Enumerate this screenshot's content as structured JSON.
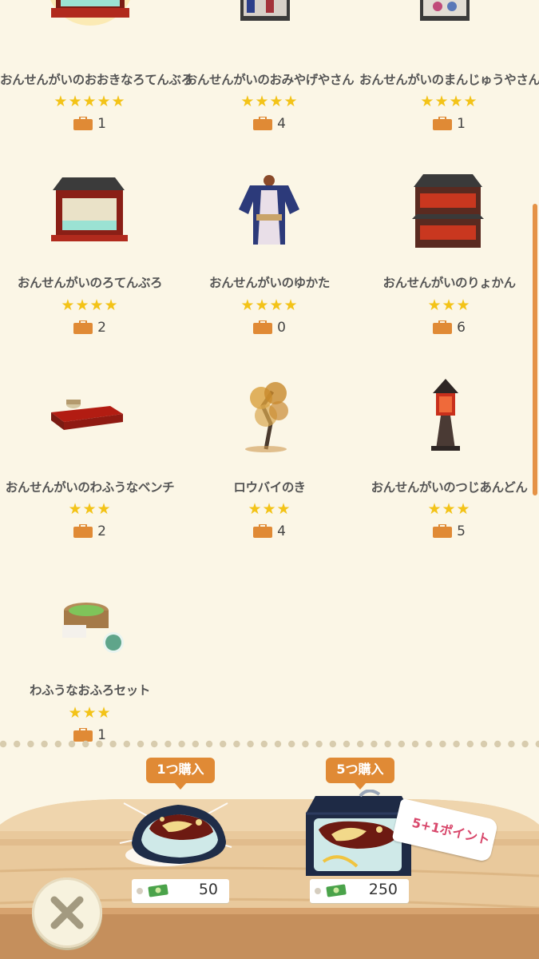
{
  "items": [
    {
      "name": "おんせんがいのおおきなろてんぶろ",
      "stars": "★★★★★",
      "count": "1",
      "art": "big-bath"
    },
    {
      "name": "おんせんがいのおみやげやさん",
      "stars": "★★★★",
      "count": "4",
      "art": "souvenir-shop"
    },
    {
      "name": "おんせんがいのまんじゅうやさん",
      "stars": "★★★★",
      "count": "1",
      "art": "manju-shop"
    },
    {
      "name": "おんせんがいのろてんぶろ",
      "stars": "★★★★",
      "count": "2",
      "art": "bath"
    },
    {
      "name": "おんせんがいのゆかた",
      "stars": "★★★★",
      "count": "0",
      "art": "yukata"
    },
    {
      "name": "おんせんがいのりょかん",
      "stars": "★★★",
      "count": "6",
      "art": "ryokan"
    },
    {
      "name": "おんせんがいのわふうなベンチ",
      "stars": "★★★",
      "count": "2",
      "art": "bench"
    },
    {
      "name": "ロウバイのき",
      "stars": "★★★",
      "count": "4",
      "art": "tree"
    },
    {
      "name": "おんせんがいのつじあんどん",
      "stars": "★★★",
      "count": "5",
      "art": "lantern"
    },
    {
      "name": "わふうなおふろセット",
      "stars": "★★★",
      "count": "1",
      "art": "bath-set"
    }
  ],
  "shop": {
    "single": {
      "label": "1つ購入",
      "price": "50"
    },
    "bundle": {
      "label": "5つ購入",
      "price": "250",
      "bonus": "5+1ポイント"
    }
  },
  "colors": {
    "accent": "#e08a35",
    "star": "#f3c318",
    "background": "#fbf6e6",
    "bonus_text": "#d8476b"
  },
  "icons": {
    "bag": "briefcase-icon",
    "currency": "leaf-ticket-icon",
    "close": "close-icon"
  }
}
